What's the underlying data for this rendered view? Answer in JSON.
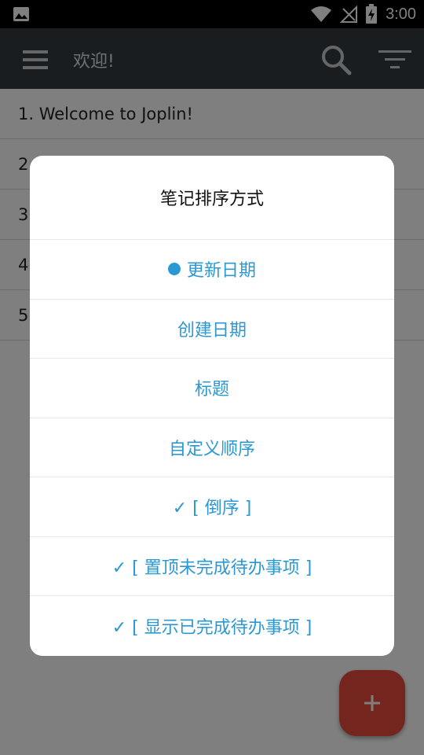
{
  "status_bar": {
    "time": "3:00"
  },
  "app_bar": {
    "title": "欢迎!"
  },
  "notes": [
    {
      "label": "1. Welcome to Joplin!"
    },
    {
      "label": "2"
    },
    {
      "label": "3"
    },
    {
      "label": "4"
    },
    {
      "label": "5"
    }
  ],
  "dialog": {
    "title": "笔记排序方式",
    "options": [
      {
        "label": "更新日期",
        "selected": true
      },
      {
        "label": "创建日期"
      },
      {
        "label": "标题"
      },
      {
        "label": "自定义顺序"
      },
      {
        "label": "✓ [ 倒序 ]"
      },
      {
        "label": "✓ [ 置顶未完成待办事项 ]"
      },
      {
        "label": "✓ [ 显示已完成待办事项 ]"
      }
    ]
  },
  "colors": {
    "app_bar": "#343a40",
    "accent": "#2a99d3",
    "fab": "#e84c3d"
  },
  "icons": {
    "status_left": "image-icon",
    "wifi": "wifi-icon",
    "signal": "no-signal-icon",
    "battery": "battery-charging-icon",
    "menu": "hamburger-menu-icon",
    "search": "search-icon",
    "sort": "sort-icon",
    "fab": "plus-icon"
  }
}
